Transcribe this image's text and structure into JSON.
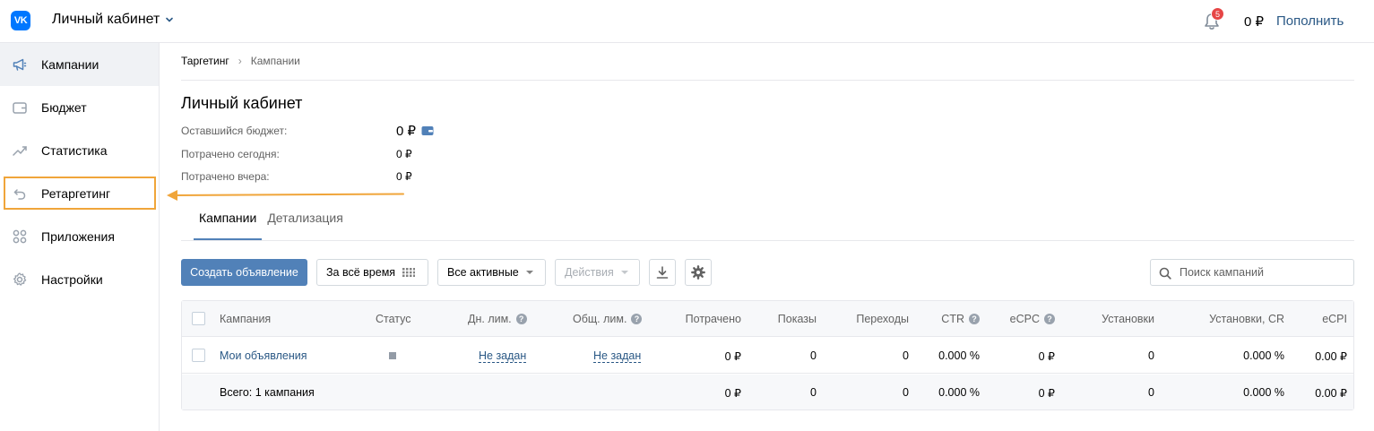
{
  "header": {
    "logo_text": "VK",
    "title": "Личный кабинет",
    "notifications_count": "5",
    "balance": "0 ₽",
    "topup_label": "Пополнить"
  },
  "sidebar": {
    "items": [
      {
        "label": "Кампании",
        "icon": "megaphone-icon",
        "active": true
      },
      {
        "label": "Бюджет",
        "icon": "wallet-icon"
      },
      {
        "label": "Статистика",
        "icon": "chart-line-icon"
      },
      {
        "label": "Ретаргетинг",
        "icon": "retarget-arrow-icon",
        "highlighted": true
      },
      {
        "label": "Приложения",
        "icon": "apps-grid-icon"
      },
      {
        "label": "Настройки",
        "icon": "gear-icon"
      }
    ],
    "highlight_color": "#f0a53a"
  },
  "breadcrumb": {
    "first": "Таргетинг",
    "separator": "›",
    "second": "Кампании"
  },
  "page": {
    "title": "Личный кабинет",
    "remaining_budget_label": "Оставшийся бюджет:",
    "remaining_budget_value": "0 ₽",
    "spent_today_label": "Потрачено сегодня:",
    "spent_today_value": "0 ₽",
    "spent_yesterday_label": "Потрачено вчера:",
    "spent_yesterday_value": "0 ₽"
  },
  "tabs": [
    {
      "label": "Кампании",
      "active": true
    },
    {
      "label": "Детализация"
    }
  ],
  "toolbar": {
    "create_label": "Создать объявление",
    "period_label": "За всё время",
    "filter_label": "Все активные",
    "actions_label": "Действия",
    "search_placeholder": "Поиск кампаний"
  },
  "table": {
    "columns": [
      "Кампания",
      "Статус",
      "Дн. лим.",
      "Общ. лим.",
      "Потрачено",
      "Показы",
      "Переходы",
      "CTR",
      "eCPC",
      "Установки",
      "Установки, CR",
      "eCPI"
    ],
    "rows": [
      {
        "campaign": "Мои объявления",
        "status": "stopped",
        "daily_limit": "Не задан",
        "total_limit": "Не задан",
        "spent": "0 ₽",
        "impressions": "0",
        "clicks": "0",
        "ctr": "0.000 %",
        "ecpc": "0 ₽",
        "installs": "0",
        "installs_cr": "0.000 %",
        "ecpi": "0.00 ₽"
      }
    ],
    "total": {
      "label": "Всего: 1 кампания",
      "spent": "0 ₽",
      "impressions": "0",
      "clicks": "0",
      "ctr": "0.000 %",
      "ecpc": "0 ₽",
      "installs": "0",
      "installs_cr": "0.000 %",
      "ecpi": "0.00 ₽"
    }
  },
  "colors": {
    "accent": "#5181b8",
    "link": "#2a5885",
    "badge": "#e64646",
    "vk_blue": "#0077ff"
  }
}
